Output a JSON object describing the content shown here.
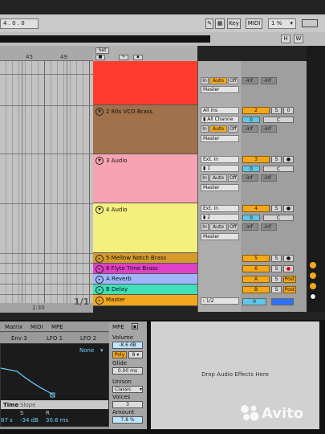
{
  "transport": {
    "position": "4 . 0 . 0",
    "key_label": "Key",
    "midi_label": "MIDI",
    "cpu": "1 %",
    "h_label": "H",
    "w_label": "W"
  },
  "ruler": {
    "marks": [
      "45",
      "49"
    ],
    "set_label": "Set"
  },
  "timeline": {
    "time": "1:30",
    "zoom": "1/1"
  },
  "tracks": [
    {
      "name": "",
      "color": "#ff3b30",
      "input": "",
      "channel": "",
      "monitor": [
        "In",
        "Auto",
        "Off"
      ],
      "output": "Master",
      "sends": [
        "-inf",
        "-inf"
      ],
      "number": "",
      "solo": "",
      "arm": ""
    },
    {
      "name": "2 80s VCO Brass",
      "color": "#a0714a",
      "input": "All Ins",
      "channel": "All Channe",
      "monitor": [
        "In",
        "Auto",
        "Off"
      ],
      "output": "Master",
      "sends": [
        "-inf",
        "-inf"
      ],
      "number": "2",
      "solo": "S",
      "arm": "0",
      "pan": "C",
      "vol": "0"
    },
    {
      "name": "3 Audio",
      "color": "#f7a3b4",
      "input": "Ext. In",
      "channel": "1",
      "monitor": [
        "In",
        "Auto",
        "Off"
      ],
      "output": "Master",
      "sends": [
        "-inf",
        "-inf"
      ],
      "number": "3",
      "solo": "S",
      "arm": "●",
      "pan": "C",
      "vol": "0"
    },
    {
      "name": "4 Audio",
      "color": "#f5ef7e",
      "input": "Ext. In",
      "channel": "2",
      "monitor": [
        "In",
        "Auto",
        "Off"
      ],
      "output": "Master",
      "sends": [
        "-inf",
        "-inf"
      ],
      "number": "4",
      "solo": "S",
      "arm": "●",
      "pan": "C",
      "vol": "0"
    }
  ],
  "small_tracks": [
    {
      "name": "5 Mellow Notch Brass",
      "color": "#d49a2c",
      "number": "5",
      "solo": "S",
      "arm": "●"
    },
    {
      "name": "6 Flyte Time Brass",
      "color": "#e040c8",
      "number": "6",
      "solo": "S",
      "arm": "●"
    },
    {
      "name": "A Reverb",
      "color": "#9fb6ff",
      "number": "A",
      "solo": "S",
      "post": "Post"
    },
    {
      "name": "B Delay",
      "color": "#3fe0b8",
      "number": "B",
      "solo": "S",
      "post": "Post"
    }
  ],
  "master": {
    "name": "Master",
    "color": "#f2a81d",
    "output": "1/2",
    "vol": "0"
  },
  "device": {
    "tabs": [
      "Matrix",
      "MIDI",
      "MPE"
    ],
    "env_tabs": [
      "Env 3",
      "LFO 1",
      "LFO 2"
    ],
    "mpe_label": "MPE",
    "none_label": "None",
    "time_label": "Time",
    "slope_label": "Slope",
    "readouts": [
      {
        "label": "",
        "value": "87 s"
      },
      {
        "label": "S",
        "value": "-34 dB"
      },
      {
        "label": "R",
        "value": "30.6 ms"
      }
    ],
    "volume_label": "Volume",
    "volume_value": "-8.6 dB",
    "poly_label": "Poly",
    "poly_value": "8",
    "glide_label": "Glide",
    "glide_value": "0.00 ms",
    "unison_label": "Unison",
    "unison_value": "Classic",
    "voices_label": "Voices",
    "voices_value": "3",
    "amount_label": "Amount",
    "amount_value": "7.8 %"
  },
  "drop_zone": {
    "text": "Drop Audio Effects Here"
  },
  "watermark": {
    "text": "Avito"
  }
}
